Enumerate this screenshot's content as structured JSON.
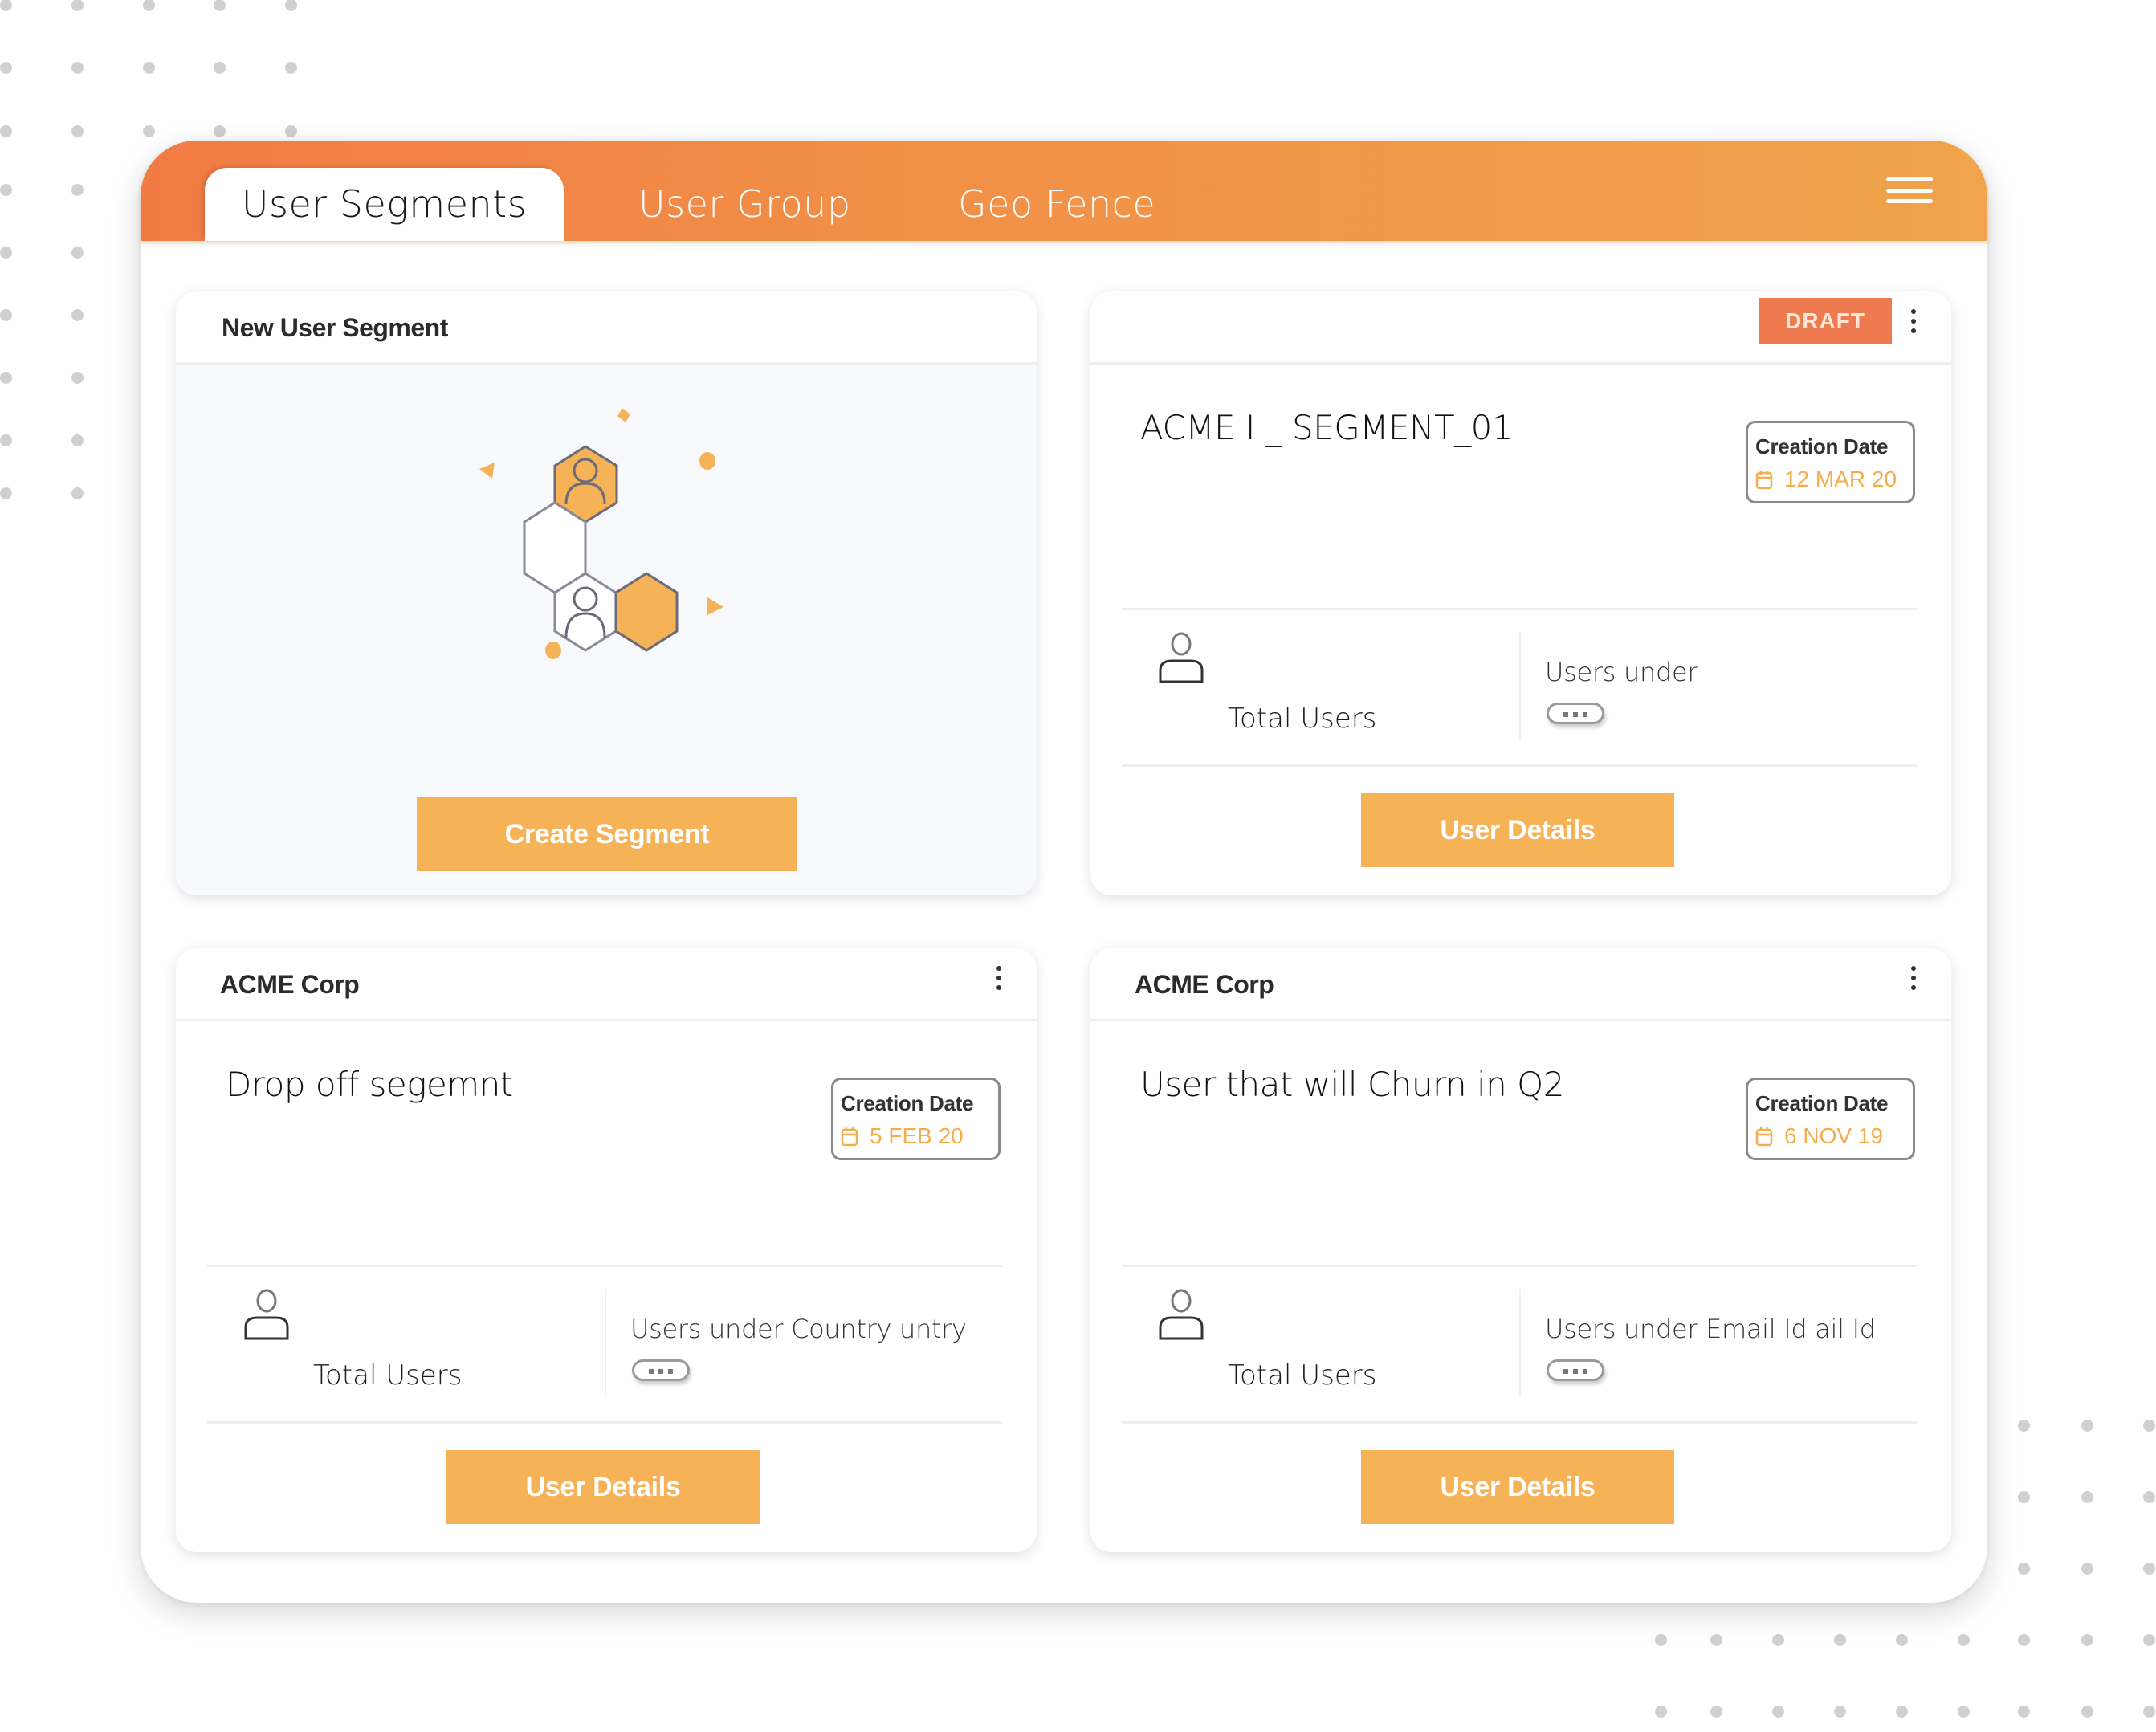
{
  "tabs": [
    {
      "label": "User Segments",
      "active": true
    },
    {
      "label": "User Group",
      "active": false
    },
    {
      "label": "Geo Fence",
      "active": false
    }
  ],
  "menu_icon": "hamburger-menu-icon",
  "colors": {
    "header_gradient_start": "#f27b44",
    "header_gradient_end": "#f0a44b",
    "accent_button": "#f5b256",
    "draft_badge": "#ee7a4f",
    "date_text": "#f5ac4c"
  },
  "new_segment_card": {
    "title": "New User Segment",
    "illustration": "user-hexagon-network-illustration",
    "button_label": "Create Segment"
  },
  "segment_cards": [
    {
      "header_title": "",
      "status_badge": "DRAFT",
      "segment_name": "ACME I _ SEGMENT_01",
      "date_label": "Creation Date",
      "date_value": "12 MAR 20",
      "total_users_label": "Total Users",
      "users_under_label": "Users under",
      "button_label": "User Details"
    },
    {
      "header_title": "ACME Corp",
      "status_badge": "",
      "segment_name": "Drop off segemnt",
      "date_label": "Creation Date",
      "date_value": "5 FEB 20",
      "total_users_label": "Total Users",
      "users_under_label": "Users under Country untry",
      "button_label": "User Details"
    },
    {
      "header_title": "ACME Corp",
      "status_badge": "",
      "segment_name": "User that will Churn in Q2",
      "date_label": "Creation Date",
      "date_value": "6 NOV 19",
      "total_users_label": "Total Users",
      "users_under_label": "Users under Email Id ail Id",
      "button_label": "User Details"
    }
  ]
}
